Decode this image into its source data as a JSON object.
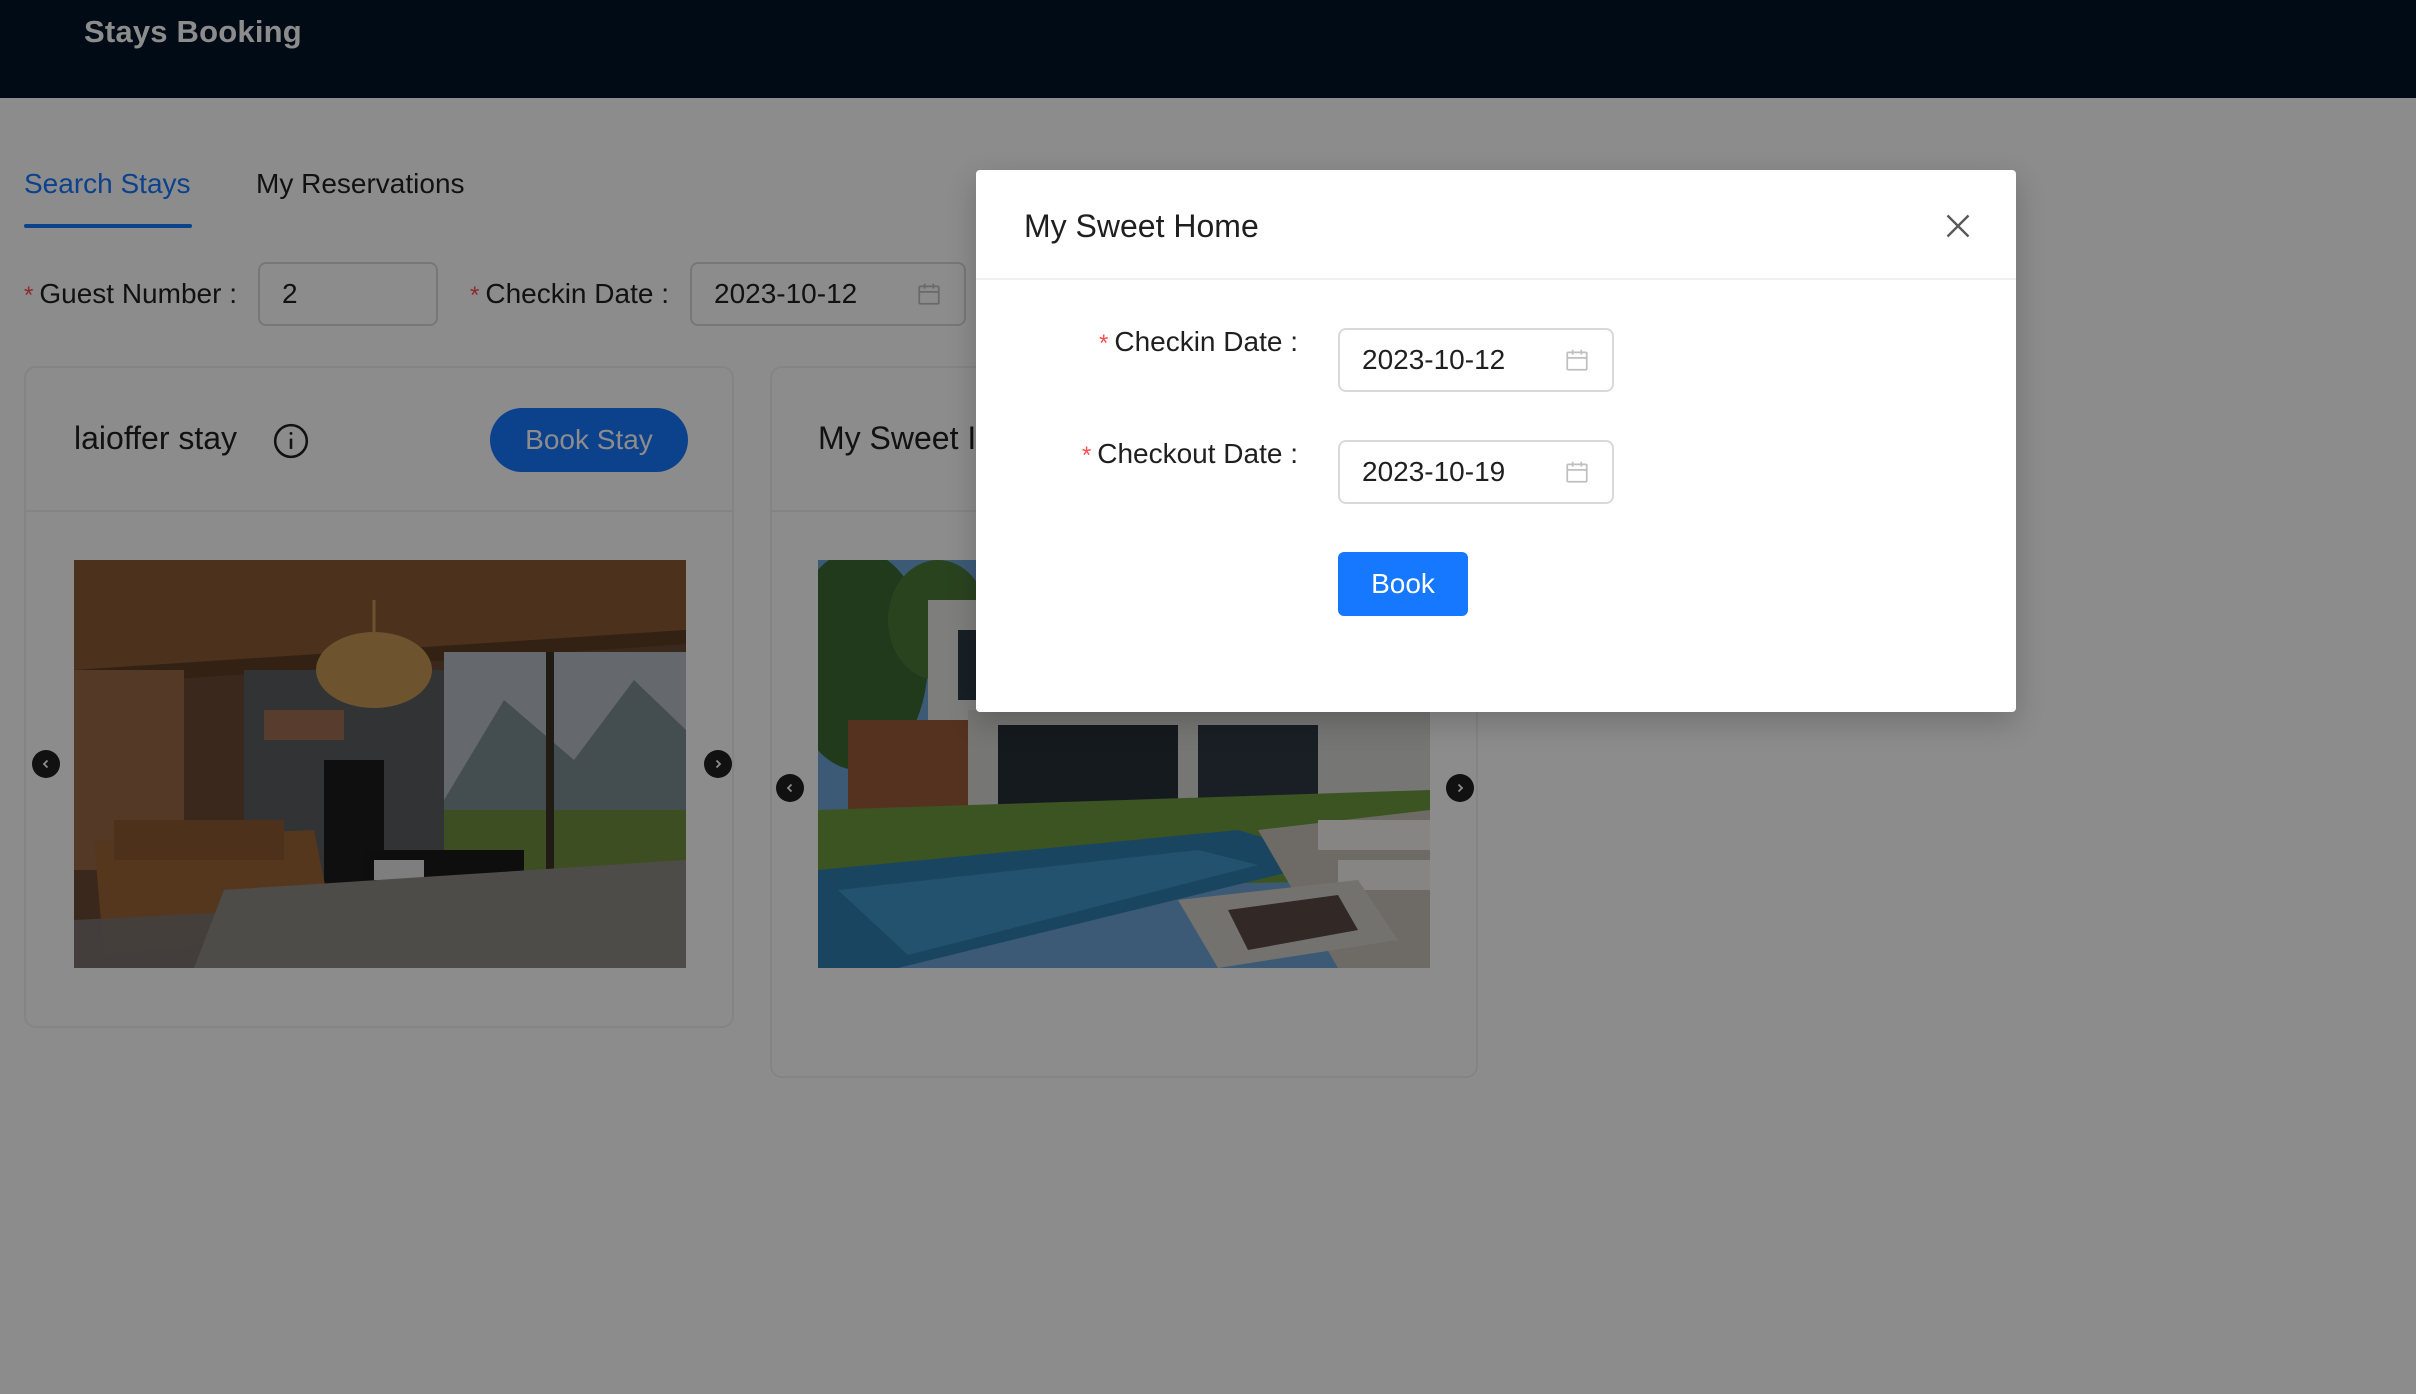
{
  "app": {
    "title": "Stays Booking"
  },
  "tabs": [
    {
      "label": "Search Stays",
      "active": true
    },
    {
      "label": "My Reservations",
      "active": false
    }
  ],
  "search": {
    "guest_label": "Guest Number",
    "guest_value": "2",
    "checkin_label": "Checkin Date",
    "checkin_value": "2023-10-12"
  },
  "stays": [
    {
      "title": "laioffer stay",
      "book_label": "Book Stay",
      "image": "living-room-photo"
    },
    {
      "title": "My Sweet Home",
      "visible_title": "My Sweet I",
      "image": "pool-house-photo"
    }
  ],
  "modal": {
    "title": "My Sweet Home",
    "checkin_label": "Checkin Date",
    "checkin_value": "2023-10-12",
    "checkout_label": "Checkout Date",
    "checkout_value": "2023-10-19",
    "book_label": "Book"
  },
  "colors": {
    "header_bg": "#001529",
    "primary": "#1677ff",
    "required": "#ff4d4f",
    "mask": "rgba(0,0,0,0.45)"
  }
}
